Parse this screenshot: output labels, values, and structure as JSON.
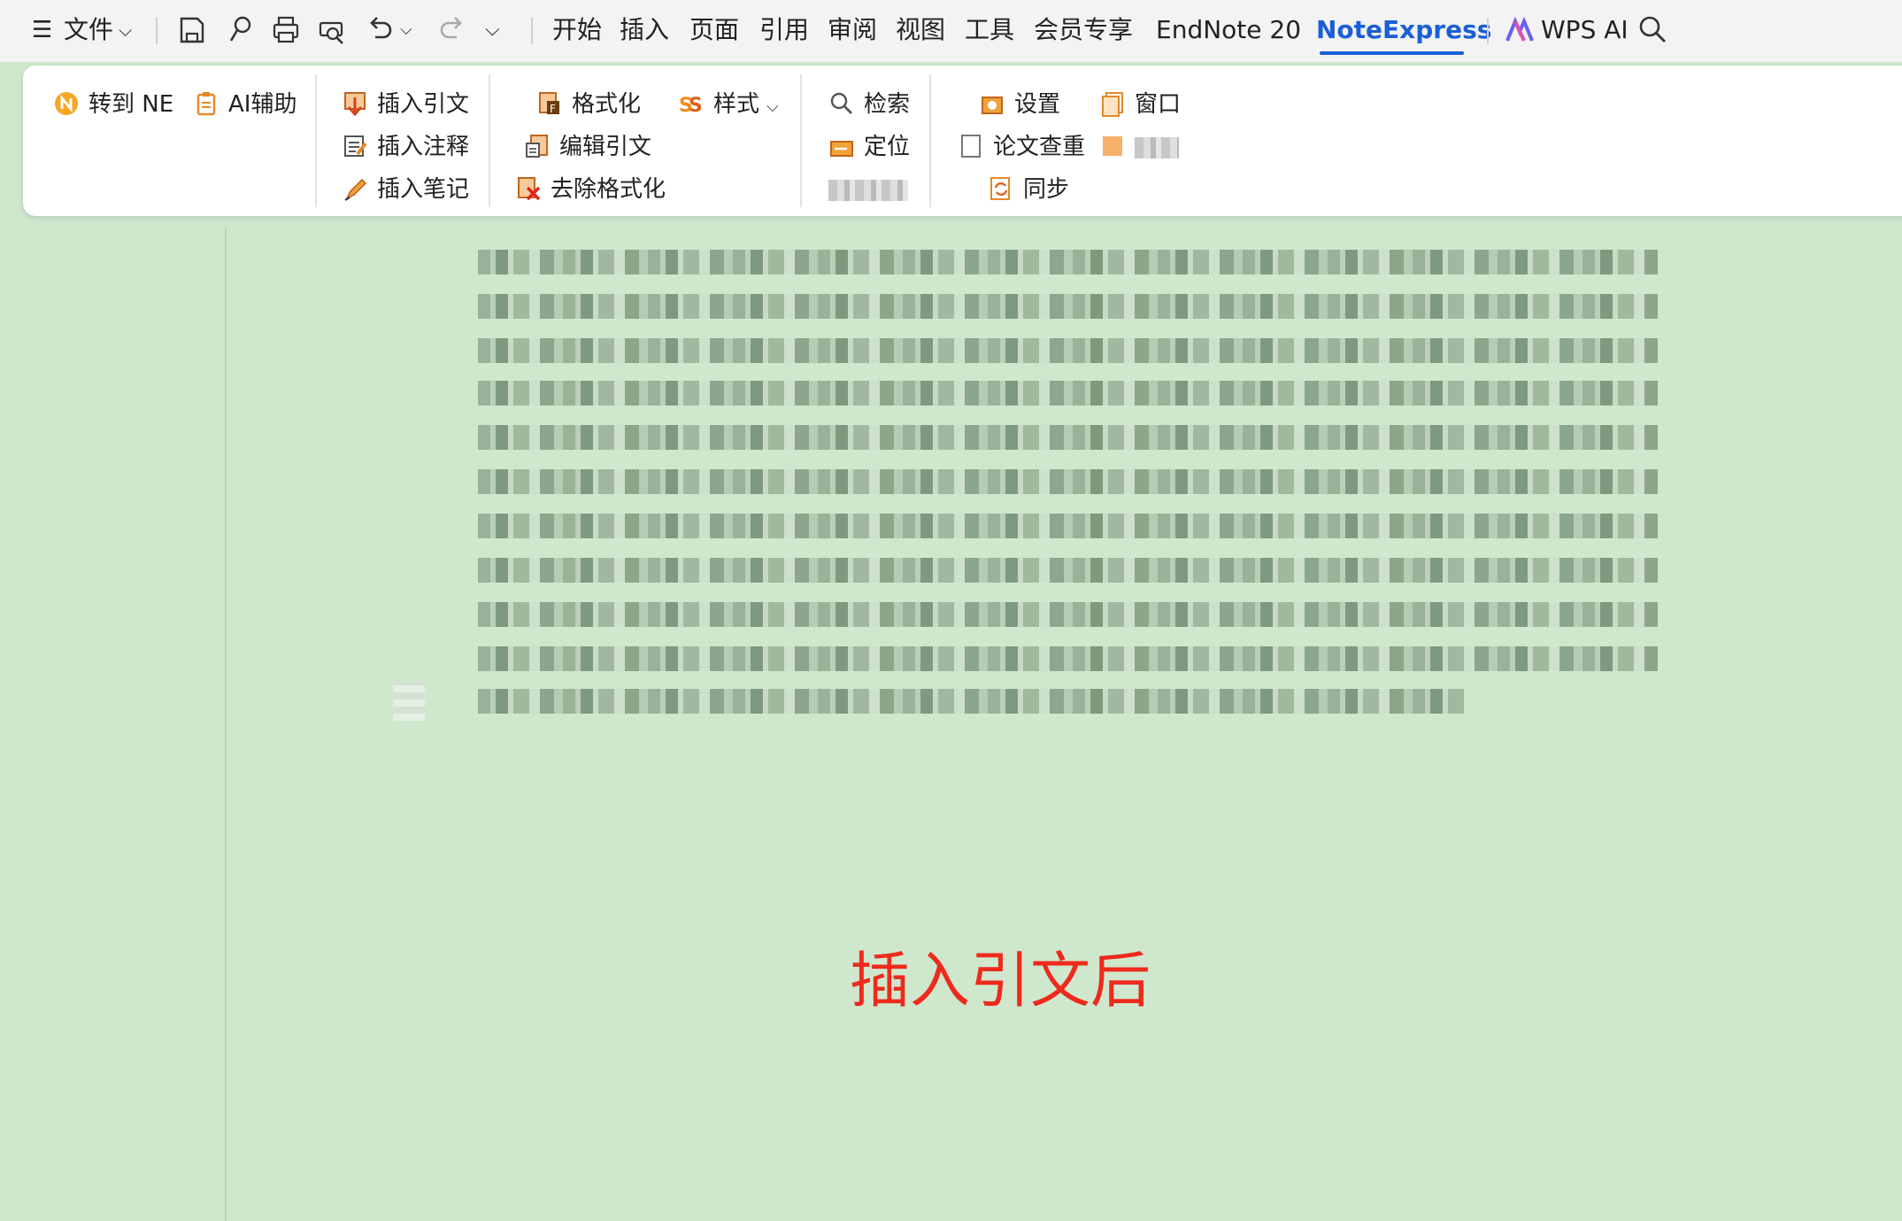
{
  "menubar": {
    "file_label": "文件",
    "tabs": [
      "开始",
      "插入",
      "页面",
      "引用",
      "审阅",
      "视图",
      "工具",
      "会员专享",
      "EndNote 20",
      "NoteExpress"
    ],
    "active_tab": "NoteExpress",
    "wps_ai_label": "WPS AI"
  },
  "ribbon": {
    "to_ne": "转到 NE",
    "ai_assist": "AI辅助",
    "insert_citation": "插入引文",
    "insert_note": "插入注释",
    "insert_memo": "插入笔记",
    "format": "格式化",
    "style": "样式",
    "edit_citation": "编辑引文",
    "remove_format": "去除格式化",
    "search": "检索",
    "locate": "定位",
    "settings": "设置",
    "window": "窗口",
    "paper_check": "论文查重",
    "sync": "同步"
  },
  "document": {
    "caption": "插入引文后"
  },
  "colors": {
    "accent": "#1a5fd6",
    "caption": "#ee2a1d",
    "background": "#cfe6cd"
  }
}
